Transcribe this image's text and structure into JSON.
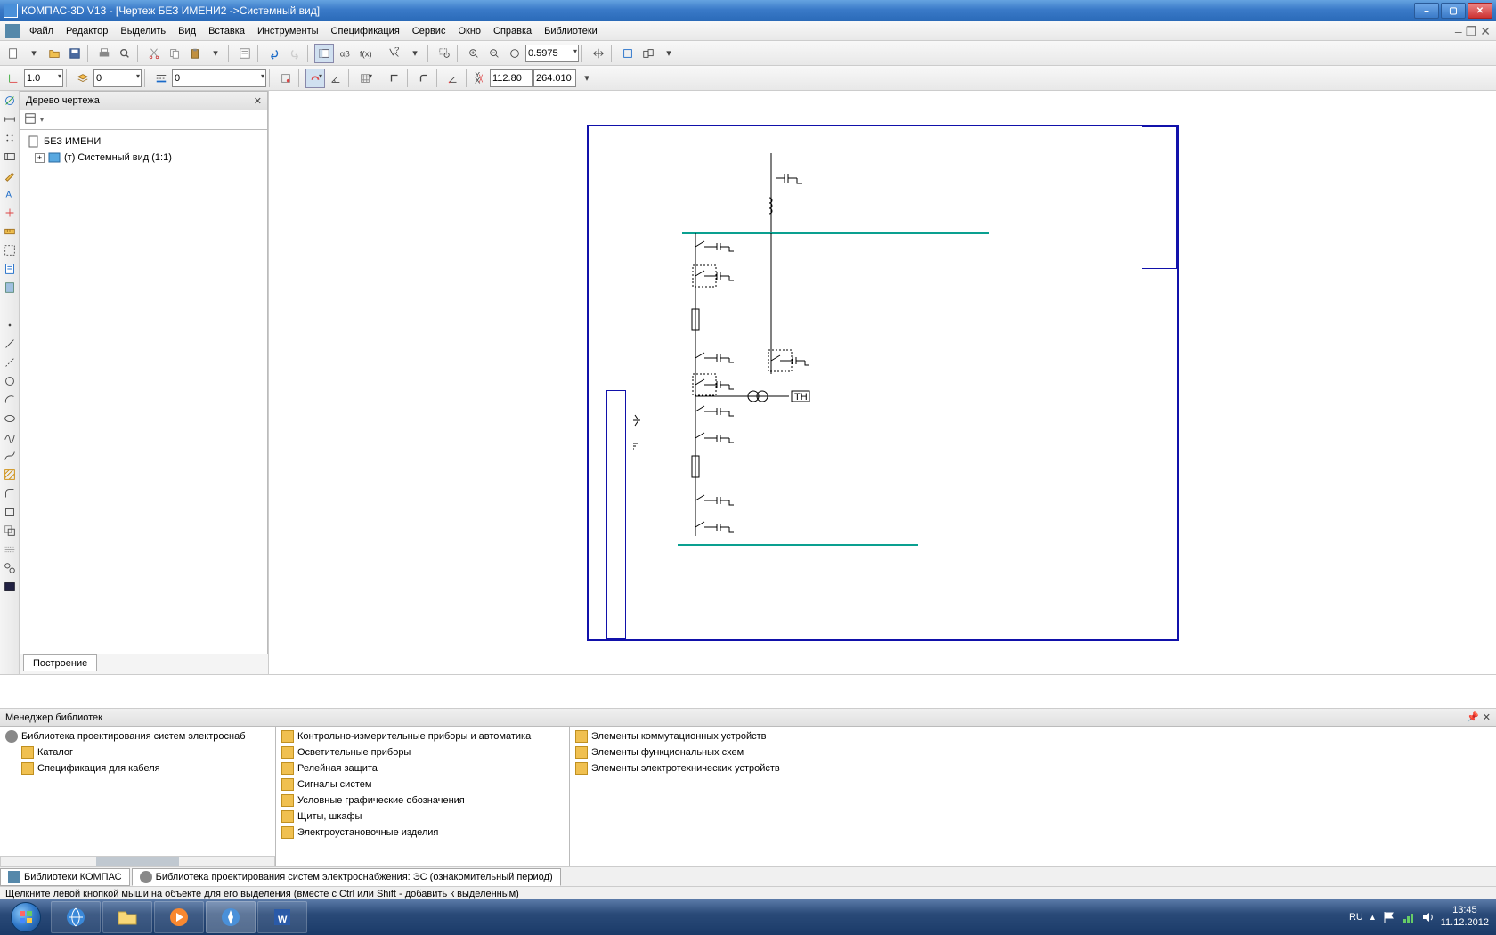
{
  "titlebar": {
    "text": "КОМПАС-3D V13 - [Чертеж БЕЗ ИМЕНИ2 ->Системный вид]"
  },
  "menus": {
    "file": "Файл",
    "edit": "Редактор",
    "select": "Выделить",
    "view": "Вид",
    "insert": "Вставка",
    "tools": "Инструменты",
    "spec": "Спецификация",
    "service": "Сервис",
    "window": "Окно",
    "help": "Справка",
    "libs": "Библиотеки"
  },
  "toolbar1": {
    "zoom": "0.5975"
  },
  "toolbar2": {
    "scale": "1.0",
    "layer": "0",
    "style": "0",
    "x": "112.80",
    "y": "264.010"
  },
  "tree": {
    "title": "Дерево чертежа",
    "root": "БЕЗ ИМЕНИ",
    "view": "(т) Системный вид (1:1)",
    "tab": "Построение"
  },
  "schematic": {
    "label": "ТН"
  },
  "libmgr": {
    "title": "Менеджер библиотек",
    "tree": {
      "root": "Библиотека проектирования систем электроснаб",
      "cat": "Каталог",
      "spec": "Спецификация для кабеля"
    },
    "col2": [
      "Контрольно-измерительные приборы и автоматика",
      "Осветительные приборы",
      "Релейная защита",
      "Сигналы систем",
      "Условные графические обозначения",
      "Щиты, шкафы",
      "Электроустановочные изделия"
    ],
    "col3": [
      "Элементы коммутационных устройств",
      "Элементы функциональных схем",
      "Элементы электротехнических устройств"
    ],
    "tab1": "Библиотеки КОМПАС",
    "tab2": "Библиотека проектирования систем электроснабжения: ЭС (ознакомительный период)"
  },
  "status": {
    "hint": "Щелкните левой кнопкой мыши на объекте для его выделения (вместе с Ctrl или Shift - добавить к выделенным)"
  },
  "taskbar": {
    "lang": "RU",
    "time": "13:45",
    "date": "11.12.2012"
  }
}
